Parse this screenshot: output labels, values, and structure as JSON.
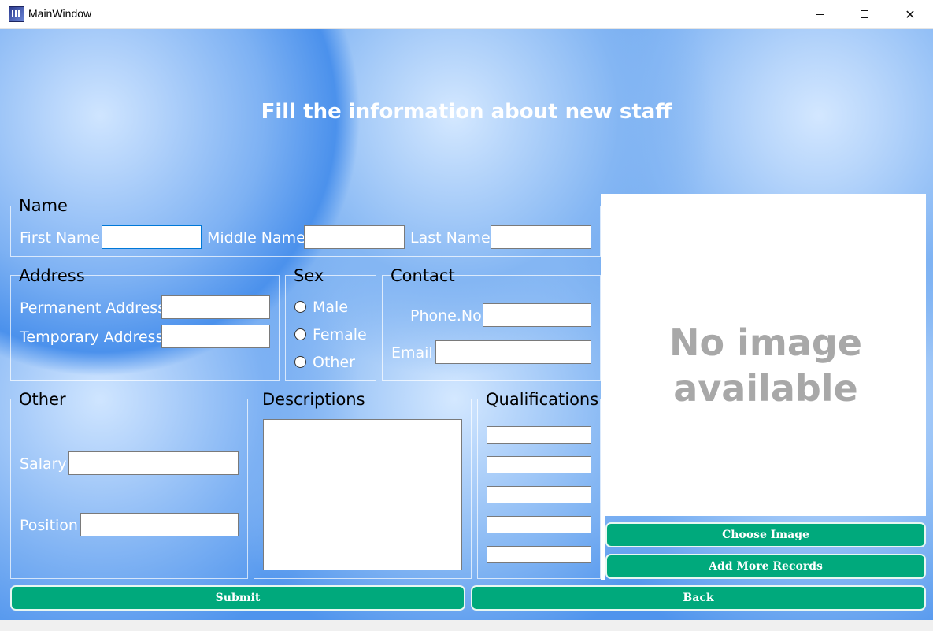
{
  "window": {
    "title": "MainWindow",
    "icon": "app-icon",
    "controls": [
      "minimize-icon",
      "maximize-icon",
      "close-icon"
    ],
    "close_glyph": "✕"
  },
  "form": {
    "heading": "Fill the information about new staff",
    "name_group": {
      "title": "Name",
      "first_name_label": "First Name",
      "middle_name_label": "Middle Name",
      "last_name_label": "Last Name",
      "first_name_value": "",
      "middle_name_value": "",
      "last_name_value": ""
    },
    "address_group": {
      "title": "Address",
      "permanent_label": "Permanent Address",
      "temporary_label": "Temporary Address",
      "permanent_value": "",
      "temporary_value": ""
    },
    "sex_group": {
      "title": "Sex",
      "options": [
        "Male",
        "Female",
        "Other"
      ]
    },
    "contact_group": {
      "title": "Contact",
      "phone_label": "Phone.No",
      "email_label": "Email",
      "phone_value": "",
      "email_value": ""
    },
    "other_group": {
      "title": "Other",
      "salary_label": "Salary",
      "position_label": "Position",
      "salary_value": "",
      "position_value": ""
    },
    "descriptions_group": {
      "title": "Descriptions",
      "value": ""
    },
    "qualifications_group": {
      "title": "Qualifications",
      "values": [
        "",
        "",
        "",
        "",
        ""
      ]
    }
  },
  "image_panel": {
    "line1": "No image",
    "line2": "available"
  },
  "buttons": {
    "choose_image": "Choose Image",
    "add_more_records": "Add More Records",
    "submit": "Submit",
    "back": "Back"
  },
  "colors": {
    "background_blue": "#4f94ed",
    "button_green": "#00a97c",
    "placeholder_gray": "#a8a8a8"
  }
}
